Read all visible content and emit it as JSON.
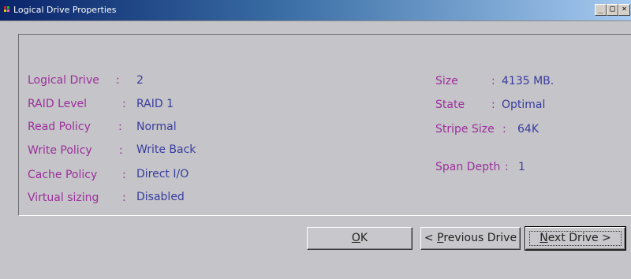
{
  "window": {
    "title": "Logical Drive Properties",
    "controls": {
      "minimize": "_",
      "maximize": "□",
      "close": "×"
    }
  },
  "properties_left": [
    {
      "label": "Logical Drive",
      "value": "2"
    },
    {
      "label": "RAID Level",
      "value": "RAID 1"
    },
    {
      "label": "Read Policy",
      "value": "Normal"
    },
    {
      "label": "Write Policy",
      "value": "Write Back"
    },
    {
      "label": "Cache Policy",
      "value": "Direct I/O"
    },
    {
      "label": "Virtual sizing",
      "value": "Disabled"
    }
  ],
  "properties_right": [
    {
      "label": "Size",
      "value": "4135 MB."
    },
    {
      "label": "State",
      "value": "Optimal"
    },
    {
      "label": "Stripe Size",
      "value": "64K"
    },
    {
      "label": "Span Depth",
      "value": "1"
    }
  ],
  "buttons": {
    "ok": {
      "mnemonic": "O",
      "rest": "K"
    },
    "previous": {
      "prefix": "< ",
      "mnemonic": "P",
      "rest": "revious Drive"
    },
    "next": {
      "mnemonic": "N",
      "rest": "ext Drive >"
    }
  },
  "colors": {
    "label": "#9b2f9c",
    "value": "#383c9e",
    "background": "#c5c4c8"
  }
}
